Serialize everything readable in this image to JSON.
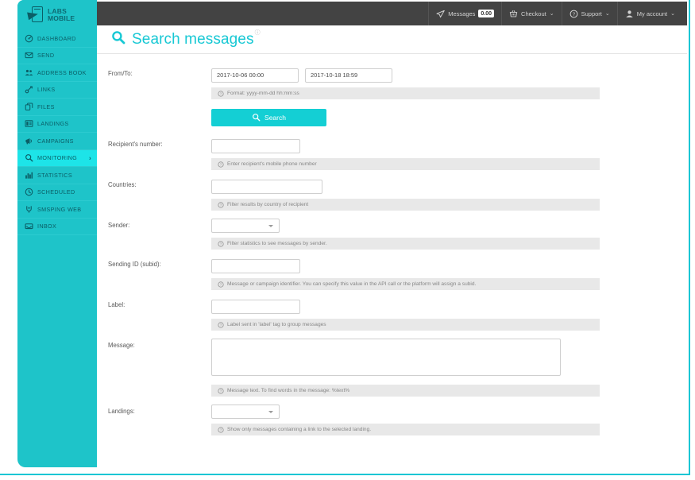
{
  "brand": {
    "name_line1": "LABS",
    "name_line2": "MOBILE",
    "accent": "#1ec4c9",
    "accent_bright": "#1de4e8",
    "topbar_color": "#434343"
  },
  "topbar": {
    "items": [
      {
        "label": "Messages",
        "icon": "paper-plane-icon",
        "badge": "0.00",
        "caret": false
      },
      {
        "label": "Checkout",
        "icon": "basket-icon",
        "badge": null,
        "caret": true
      },
      {
        "label": "Support",
        "icon": "help-circle-icon",
        "badge": null,
        "caret": true
      },
      {
        "label": "My account",
        "icon": "user-icon",
        "badge": null,
        "caret": true
      }
    ],
    "caret_glyph": "⌄"
  },
  "sidebar": {
    "items": [
      {
        "label": "DASHBOARD",
        "icon": "dashboard-icon",
        "active": false,
        "chevron": ""
      },
      {
        "label": "SEND",
        "icon": "envelope-icon",
        "active": false,
        "chevron": ""
      },
      {
        "label": "ADDRESS BOOK",
        "icon": "contacts-icon",
        "active": false,
        "chevron": ""
      },
      {
        "label": "LINKS",
        "icon": "link-icon",
        "active": false,
        "chevron": ""
      },
      {
        "label": "FILES",
        "icon": "files-icon",
        "active": false,
        "chevron": ""
      },
      {
        "label": "LANDINGS",
        "icon": "landing-icon",
        "active": false,
        "chevron": ""
      },
      {
        "label": "CAMPAIGNS",
        "icon": "megaphone-icon",
        "active": false,
        "chevron": ""
      },
      {
        "label": "MONITORING",
        "icon": "search-icon",
        "active": true,
        "chevron": "›"
      },
      {
        "label": "STATISTICS",
        "icon": "bar-chart-icon",
        "active": false,
        "chevron": ""
      },
      {
        "label": "SCHEDULED",
        "icon": "clock-icon",
        "active": false,
        "chevron": ""
      },
      {
        "label": "SMSPING WEB",
        "icon": "smsping-icon",
        "active": false,
        "chevron": ""
      },
      {
        "label": "INBOX",
        "icon": "inbox-icon",
        "active": false,
        "chevron": ""
      }
    ]
  },
  "page": {
    "title": "Search messages",
    "title_icon": "search-icon",
    "help_superscript": "ⓘ"
  },
  "form": {
    "fields": [
      {
        "label": "From/To:",
        "type": "date-range",
        "value_from": "2017-10-06 00:00",
        "value_to": "2017-10-18 18:59",
        "hint": "Format: yyyy-mm-dd hh:mm:ss"
      },
      {
        "label": "Recipient's number:",
        "type": "text",
        "value": "",
        "hint": "Enter recipient's mobile phone number"
      },
      {
        "label": "Countries:",
        "type": "text",
        "value": "",
        "hint": "Filter results by country of recipient"
      },
      {
        "label": "Sender:",
        "type": "select",
        "value": "",
        "hint": "Filter statistics to see messages by sender."
      },
      {
        "label": "Sending ID (subid):",
        "type": "text",
        "value": "",
        "hint": "Message or campaign identifier. You can specify this value in the API call or the platform will assign a subid."
      },
      {
        "label": "Label:",
        "type": "text",
        "value": "",
        "hint": "Label sent in 'label' tag to group messages"
      },
      {
        "label": "Message:",
        "type": "textarea",
        "value": "",
        "hint": "Message text. To find words in the message: %text%"
      },
      {
        "label": "Landings:",
        "type": "select",
        "value": "",
        "hint": "Show only messages containing a link to the selected landing."
      }
    ],
    "search_button": "Search",
    "search_button_icon": "search-icon"
  }
}
